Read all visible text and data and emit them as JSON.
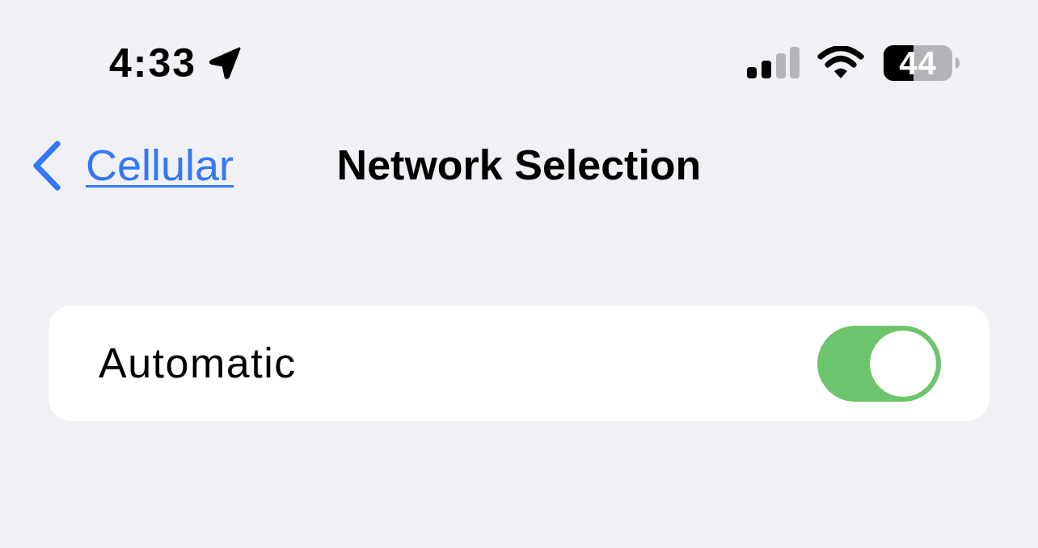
{
  "status_bar": {
    "time": "4:33",
    "battery": "44"
  },
  "nav": {
    "back_label": "Cellular",
    "title": "Network Selection"
  },
  "settings": [
    {
      "kind": "toggle",
      "label": "Automatic",
      "on": true
    }
  ]
}
